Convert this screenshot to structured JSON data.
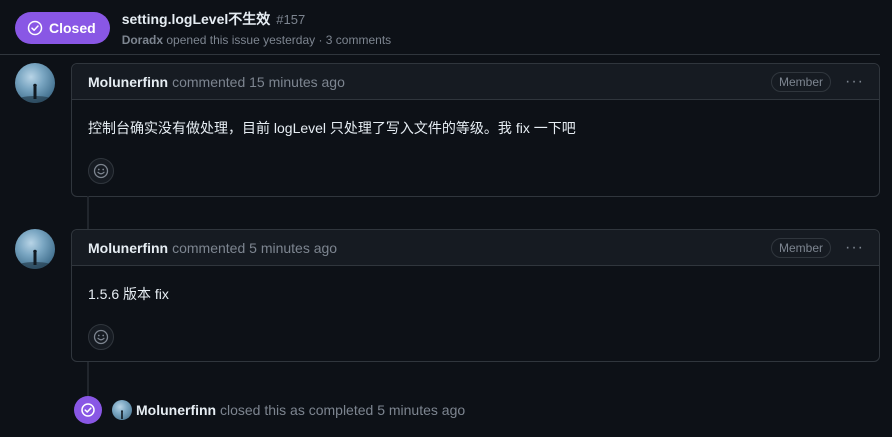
{
  "header": {
    "state_label": "Closed",
    "title": "setting.logLevel不生效",
    "number": "#157",
    "author": "Doradx",
    "meta_text": "opened this issue yesterday · 3 comments"
  },
  "comments": [
    {
      "author": "Molunerfinn",
      "action_time": "commented 15 minutes ago",
      "role": "Member",
      "body": "控制台确实没有做处理，目前 logLevel 只处理了写入文件的等级。我 fix 一下吧"
    },
    {
      "author": "Molunerfinn",
      "action_time": "commented 5 minutes ago",
      "role": "Member",
      "body": "1.5.6 版本 fix"
    }
  ],
  "event": {
    "author": "Molunerfinn",
    "text": "closed this as completed 5 minutes ago"
  },
  "colors": {
    "closed_purple": "#8957e5",
    "background": "#0d1117",
    "border": "#30363d",
    "muted_text": "#7d8590"
  },
  "icons": {
    "state": "check-circle-icon",
    "reaction": "smiley-icon",
    "menu": "kebab-horizontal-icon"
  }
}
